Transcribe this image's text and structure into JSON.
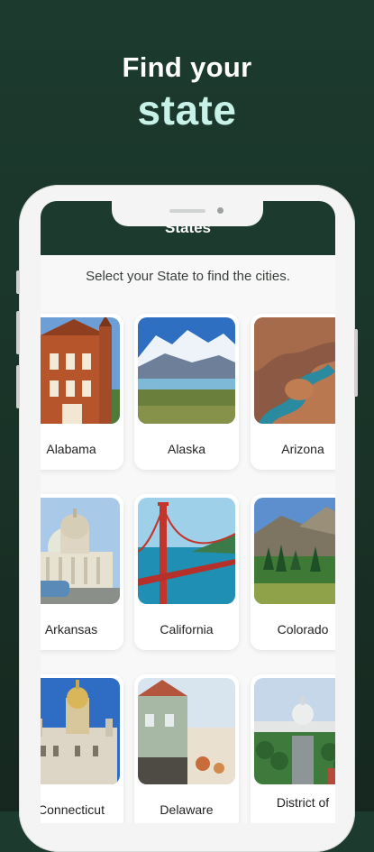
{
  "promo": {
    "line1": "Find your",
    "line2": "state"
  },
  "app": {
    "title": "States",
    "subtitle": "Select your State to find the cities.",
    "states": [
      {
        "name": "Alabama"
      },
      {
        "name": "Alaska"
      },
      {
        "name": "Arizona"
      },
      {
        "name": "Arkansas"
      },
      {
        "name": "California"
      },
      {
        "name": "Colorado"
      },
      {
        "name": "Connecticut"
      },
      {
        "name": "Delaware"
      },
      {
        "name": "District of"
      }
    ]
  },
  "colors": {
    "brand_dark": "#1c3a2e",
    "accent_mint": "#c8f2e8"
  }
}
